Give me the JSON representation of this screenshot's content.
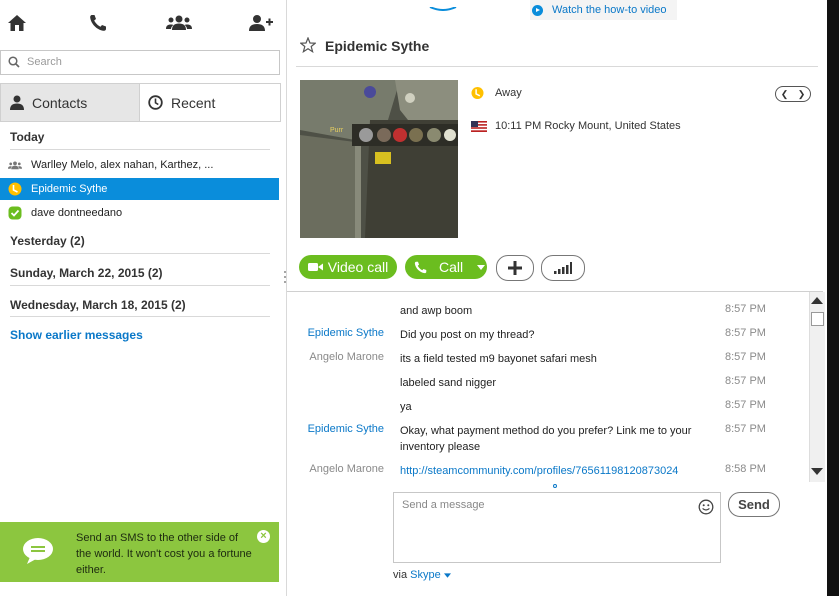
{
  "nav": {
    "icons": [
      "home-icon",
      "phone-icon",
      "group-icon",
      "add-contact-icon"
    ]
  },
  "search": {
    "placeholder": "Search"
  },
  "tabs": {
    "contacts": "Contacts",
    "recent": "Recent"
  },
  "recent": {
    "today_label": "Today",
    "items": [
      {
        "name": "Warlley Melo, alex nahan, Karthez, ...",
        "icon": "group-icon"
      },
      {
        "name": "Epidemic Sythe",
        "icon": "away-status-icon",
        "selected": true
      },
      {
        "name": "dave dontneedano",
        "icon": "online-status-icon"
      }
    ],
    "sections": [
      "Yesterday (2)",
      "Sunday, March 22, 2015 (2)",
      "Wednesday, March 18, 2015 (2)"
    ],
    "show_earlier": "Show earlier messages"
  },
  "sms_promo": {
    "text": "Send an SMS to the other side of the world. It won't cost you a fortune either.",
    "close": "×"
  },
  "howto": {
    "label": "Watch the how-to video"
  },
  "contact": {
    "name": "Epidemic Sythe",
    "status": "Away",
    "location": "10:11 PM Rocky Mount, United States"
  },
  "actions": {
    "video_call": "Video call",
    "call": "Call"
  },
  "messages": [
    {
      "who": "",
      "whoClass": "b",
      "text": "and awp boom",
      "time": "8:57 PM"
    },
    {
      "who": "Epidemic Sythe",
      "whoClass": "a",
      "text": "Did you post on my thread?",
      "time": "8:57 PM"
    },
    {
      "who": "Angelo Marone",
      "whoClass": "b",
      "text": "its a field tested m9 bayonet safari mesh",
      "time": "8:57 PM"
    },
    {
      "who": "",
      "whoClass": "b",
      "text": "labeled sand nigger",
      "time": "8:57 PM"
    },
    {
      "who": "",
      "whoClass": "b",
      "text": "ya",
      "time": "8:57 PM"
    },
    {
      "who": "Epidemic Sythe",
      "whoClass": "a",
      "text": "Okay, what payment method do you prefer? Link me to your inventory please",
      "time": "8:57 PM"
    },
    {
      "who": "Angelo Marone",
      "whoClass": "b",
      "text": "http://steamcommunity.com/profiles/76561198120873024",
      "time": "8:58 PM",
      "link": true
    }
  ],
  "compose": {
    "placeholder": "Send a message",
    "send": "Send",
    "via_prefix": "via",
    "via_service": "Skype"
  },
  "colors": {
    "accent": "#0a8ddb",
    "green": "#6bbd1f",
    "sms_bg": "#8cc63f",
    "away": "#ffc000"
  }
}
